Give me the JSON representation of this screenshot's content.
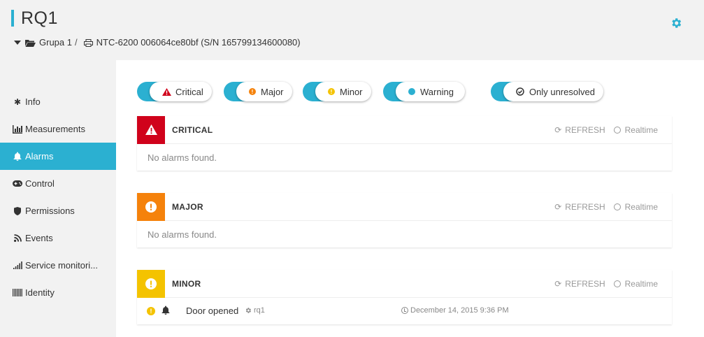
{
  "header": {
    "title": "RQ1",
    "breadcrumb": {
      "group": "Grupa 1",
      "separator": "/",
      "device": "NTC-6200 006064ce80bf (S/N 165799134600080)"
    },
    "settings_icon": "gear-icon"
  },
  "sidebar": {
    "items": [
      {
        "label": "Info",
        "icon": "asterisk-icon",
        "active": false
      },
      {
        "label": "Measurements",
        "icon": "bar-chart-icon",
        "active": false
      },
      {
        "label": "Alarms",
        "icon": "bell-icon",
        "active": true
      },
      {
        "label": "Control",
        "icon": "gamepad-icon",
        "active": false
      },
      {
        "label": "Permissions",
        "icon": "shield-icon",
        "active": false
      },
      {
        "label": "Events",
        "icon": "rss-icon",
        "active": false
      },
      {
        "label": "Service monitori...",
        "icon": "signal-icon",
        "active": false
      },
      {
        "label": "Identity",
        "icon": "barcode-icon",
        "active": false
      }
    ]
  },
  "filters": [
    {
      "label": "Critical",
      "icon": "warning-triangle-icon",
      "color": "#d0021b"
    },
    {
      "label": "Major",
      "icon": "exclamation-circle-icon",
      "color": "#f5820b"
    },
    {
      "label": "Minor",
      "icon": "exclamation-circle-icon",
      "color": "#f4c300"
    },
    {
      "label": "Warning",
      "icon": "circle-icon",
      "color": "#2bb0d1"
    },
    {
      "label": "Only unresolved",
      "icon": "check-circle-icon",
      "color": "#333333"
    }
  ],
  "panels": {
    "critical": {
      "title": "CRITICAL",
      "color": "#d0021b",
      "refresh": "REFRESH",
      "realtime": "Realtime",
      "empty": "No alarms found."
    },
    "major": {
      "title": "MAJOR",
      "color": "#f5820b",
      "refresh": "REFRESH",
      "realtime": "Realtime",
      "empty": "No alarms found."
    },
    "minor": {
      "title": "MINOR",
      "color": "#f4c300",
      "refresh": "REFRESH",
      "realtime": "Realtime",
      "alarms": [
        {
          "text": "Door opened",
          "source": "rq1",
          "time": "December 14, 2015 9:36 PM"
        }
      ]
    }
  },
  "colors": {
    "accent": "#2bb0d1"
  }
}
